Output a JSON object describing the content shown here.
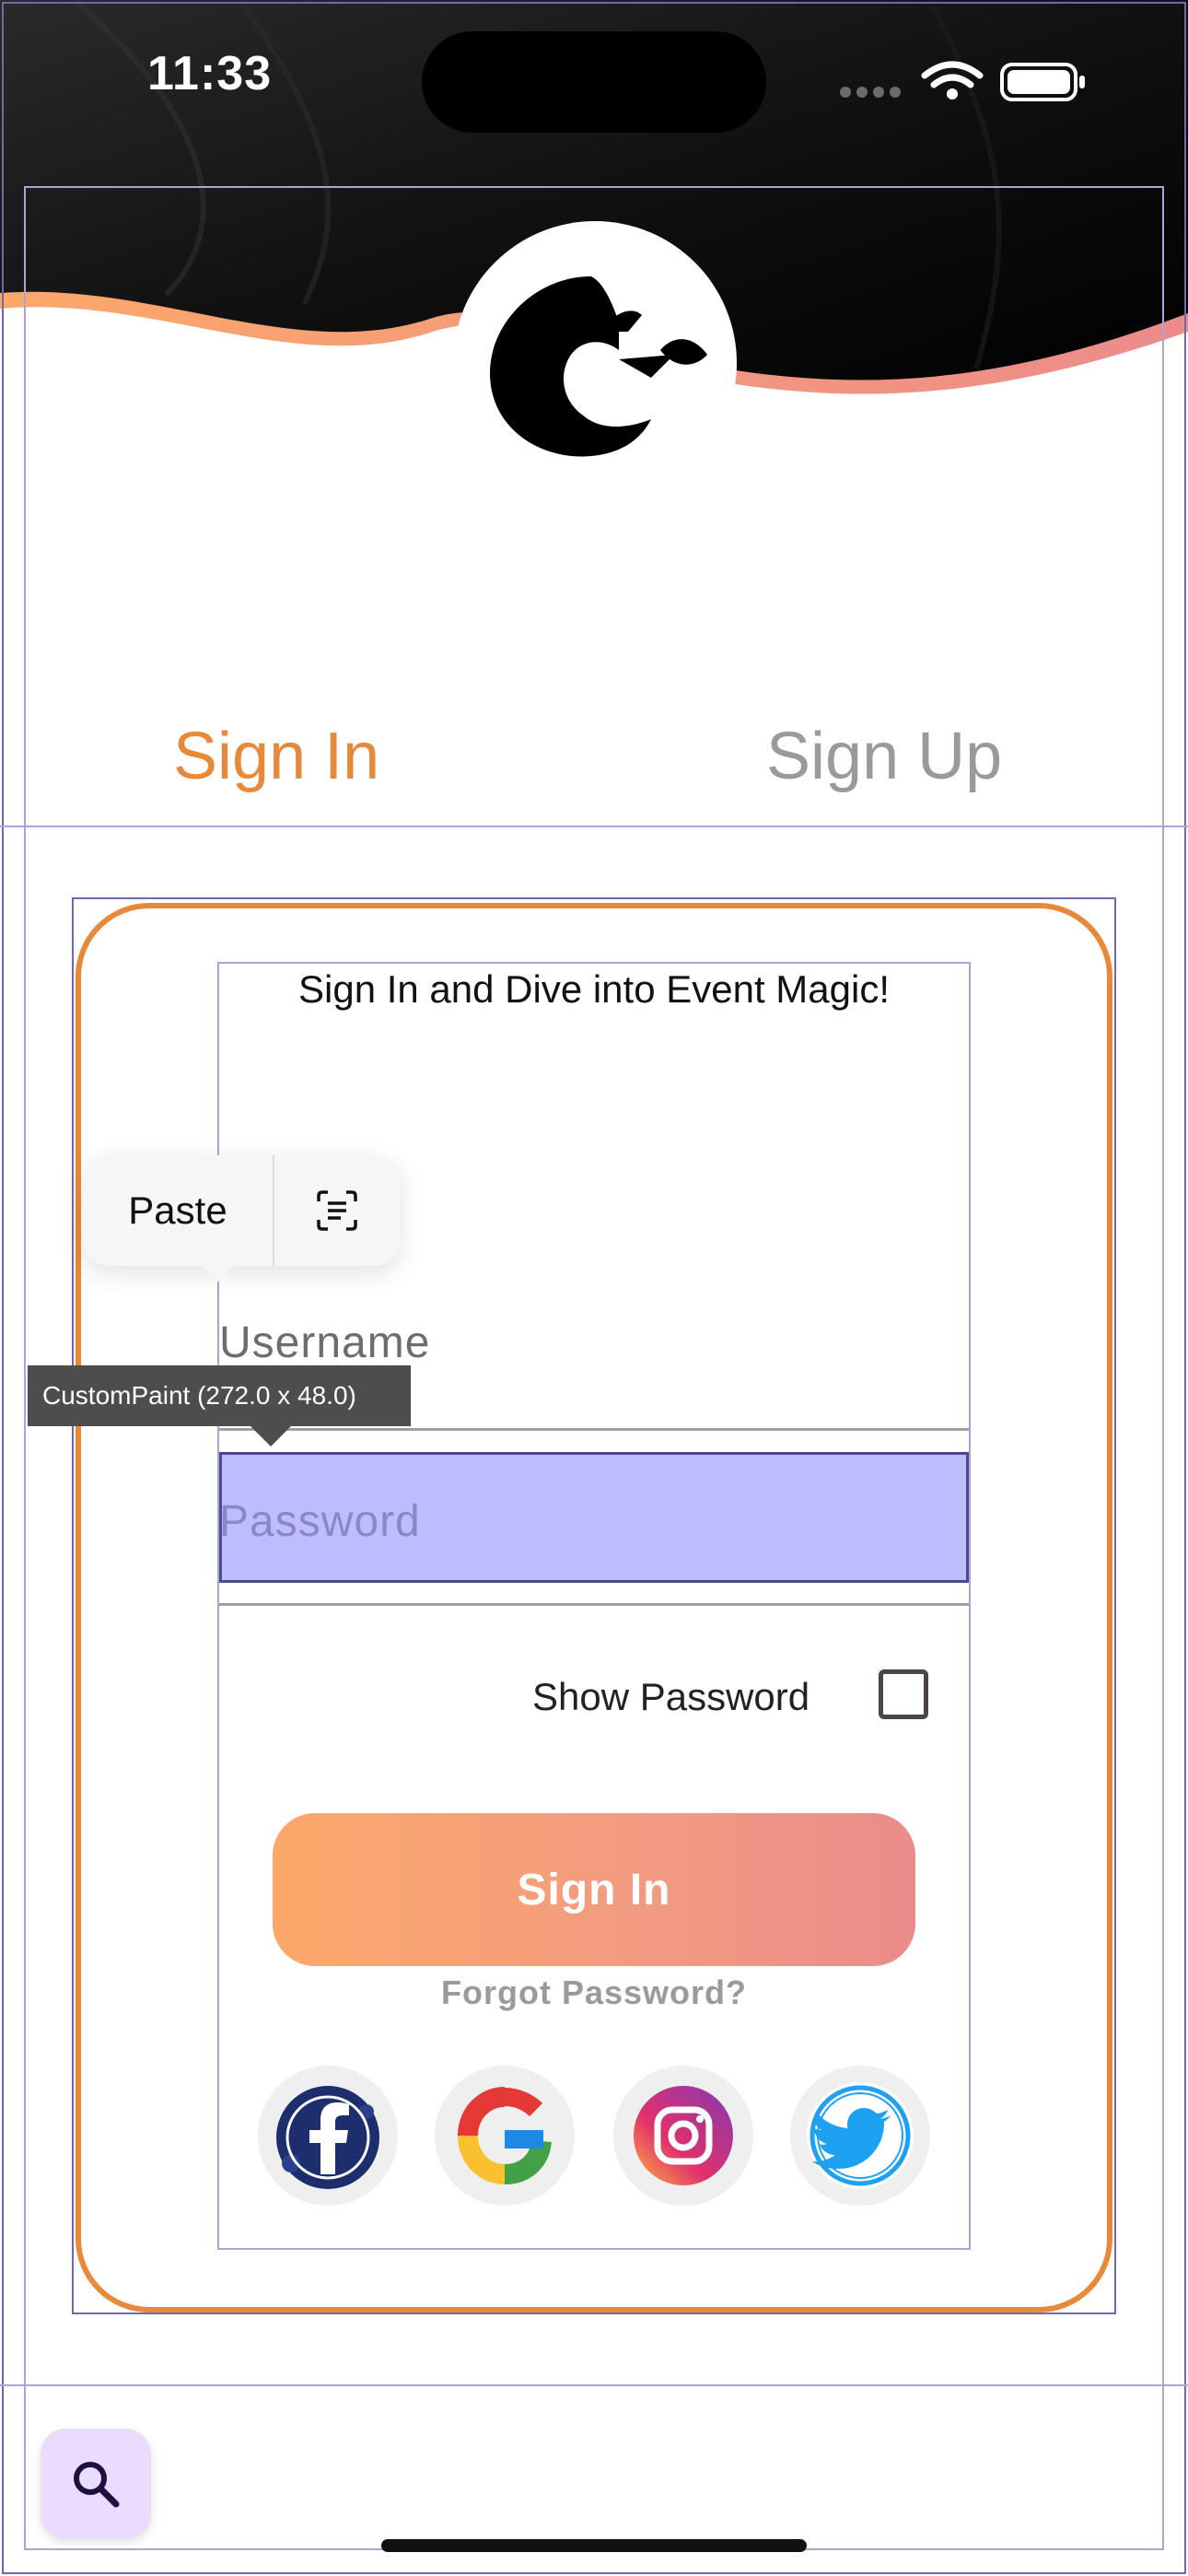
{
  "status_bar": {
    "time": "11:33"
  },
  "tabs": {
    "sign_in": "Sign In",
    "sign_up": "Sign Up"
  },
  "form": {
    "title": "Sign In and Dive into Event Magic!",
    "username_label": "Username",
    "password_placeholder": "Password",
    "show_password_label": "Show Password",
    "sign_in_button": "Sign In",
    "forgot_password": "Forgot Password?"
  },
  "social_icons": [
    "facebook-icon",
    "google-icon",
    "instagram-icon",
    "twitter-icon"
  ],
  "context_menu": {
    "paste": "Paste"
  },
  "debug_tooltip": "CustomPaint (272.0 x 48.0)",
  "colors": {
    "accent": "#e8893a",
    "inactive_tab": "#9a9a9a",
    "button_gradient_start": "#fca86a",
    "button_gradient_end": "#ec8b8b",
    "highlight": "#bcbcff"
  }
}
